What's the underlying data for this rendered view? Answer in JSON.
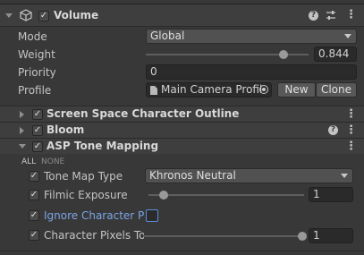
{
  "component": {
    "title": "Volume",
    "enabled": true
  },
  "fields": {
    "mode_label": "Mode",
    "mode_value": "Global",
    "weight_label": "Weight",
    "weight_value": "0.844",
    "weight_fraction": 0.844,
    "priority_label": "Priority",
    "priority_value": "0",
    "profile_label": "Profile",
    "profile_value": "Main Camera Profil",
    "new_label": "New",
    "clone_label": "Clone"
  },
  "overrides": [
    {
      "title": "Screen Space Character Outline",
      "enabled": true,
      "expanded": false
    },
    {
      "title": "Bloom",
      "enabled": true,
      "expanded": false
    },
    {
      "title": "ASP Tone Mapping",
      "enabled": true,
      "expanded": true
    }
  ],
  "toggles": {
    "all": "ALL",
    "none": "NONE"
  },
  "tone_mapping": {
    "tone_map_type_label": "Tone Map Type",
    "tone_map_type_value": "Khronos Neutral",
    "filmic_exposure_label": "Filmic Exposure",
    "filmic_exposure_value": "1",
    "filmic_exposure_fraction": 0.1,
    "ignore_character_label": "Ignore Character Pi",
    "ignore_character_checked": false,
    "character_pixels_label": "Character Pixels To",
    "character_pixels_value": "1",
    "character_pixels_fraction": 1.0
  },
  "colors": {
    "background": "#383838",
    "header": "#3e3e3e",
    "field": "#2a2a2a",
    "link_blue": "#7ba5e6"
  }
}
